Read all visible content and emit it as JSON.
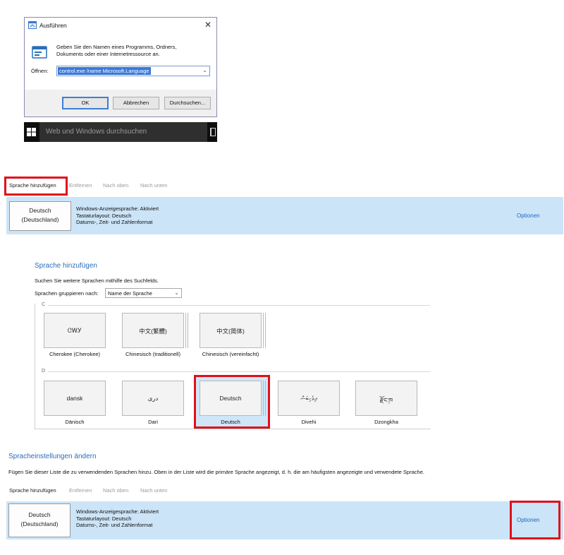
{
  "run_dialog": {
    "title": "Ausführen",
    "close": "✕",
    "description": "Geben Sie den Namen eines Programms, Ordners, Dokuments oder einer Internetressource an.",
    "open_label": "Öffnen:",
    "open_value": "control.exe /name Microsoft.Language",
    "buttons": {
      "ok": "OK",
      "cancel": "Abbrechen",
      "browse": "Durchsuchen..."
    }
  },
  "taskbar": {
    "search_placeholder": "Web und Windows durchsuchen"
  },
  "language_panel_top": {
    "toolbar": {
      "add": "Sprache hinzufügen",
      "remove": "Entfernen",
      "up": "Nach oben",
      "down": "Nach unten"
    },
    "language": {
      "name_line1": "Deutsch",
      "name_line2": "(Deutschland)",
      "info_line1": "Windows-Anzeigesprache: Aktiviert",
      "info_line2": "Tastaturlayout: Deutsch",
      "info_line3": "Datums-, Zeit- und Zahlenformat"
    },
    "options": "Optionen"
  },
  "add_language": {
    "title": "Sprache hinzufügen",
    "hint": "Suchen Sie weitere Sprachen mithilfe des Suchfelds.",
    "group_label": "Sprachen gruppieren nach:",
    "group_value": "Name der Sprache",
    "sections": [
      {
        "letter": "C",
        "cards": [
          {
            "tile": "ᏣᎳᎩ",
            "caption": "Cherokee (Cherokee)"
          },
          {
            "tile": "中文(繁體)",
            "caption": "Chinesisch (traditionell)"
          },
          {
            "tile": "中文(简体)",
            "caption": "Chinesisch (vereinfacht)"
          }
        ]
      },
      {
        "letter": "D",
        "cards": [
          {
            "tile": "dansk",
            "caption": "Dänisch"
          },
          {
            "tile": "دری",
            "caption": "Dari"
          },
          {
            "tile": "Deutsch",
            "caption": "Deutsch"
          },
          {
            "tile": "ދިވެހިބަސް",
            "caption": "Divehi"
          },
          {
            "tile": "རྫོང་ཁ",
            "caption": "Dzongkha"
          }
        ]
      }
    ]
  },
  "language_settings": {
    "title": "Spracheinstellungen ändern",
    "description": "Fügen Sie dieser Liste die zu verwendenden Sprachen hinzu. Oben in der Liste wird die primäre Sprache angezeigt, d. h. die am häufigsten angezeigte und verwendete Sprache.",
    "toolbar": {
      "add": "Sprache hinzufügen",
      "remove": "Entfernen",
      "up": "Nach oben",
      "down": "Nach unten"
    },
    "language": {
      "name_line1": "Deutsch",
      "name_line2": "(Deutschland)",
      "info_line1": "Windows-Anzeigesprache: Aktiviert",
      "info_line2": "Tastaturlayout: Deutsch",
      "info_line3": "Datums-, Zeit- und Zahlenformat"
    },
    "options": "Optionen"
  },
  "colors": {
    "highlight": "#e0101a",
    "link": "#1f66c2",
    "selection_row": "#cce4f7"
  }
}
